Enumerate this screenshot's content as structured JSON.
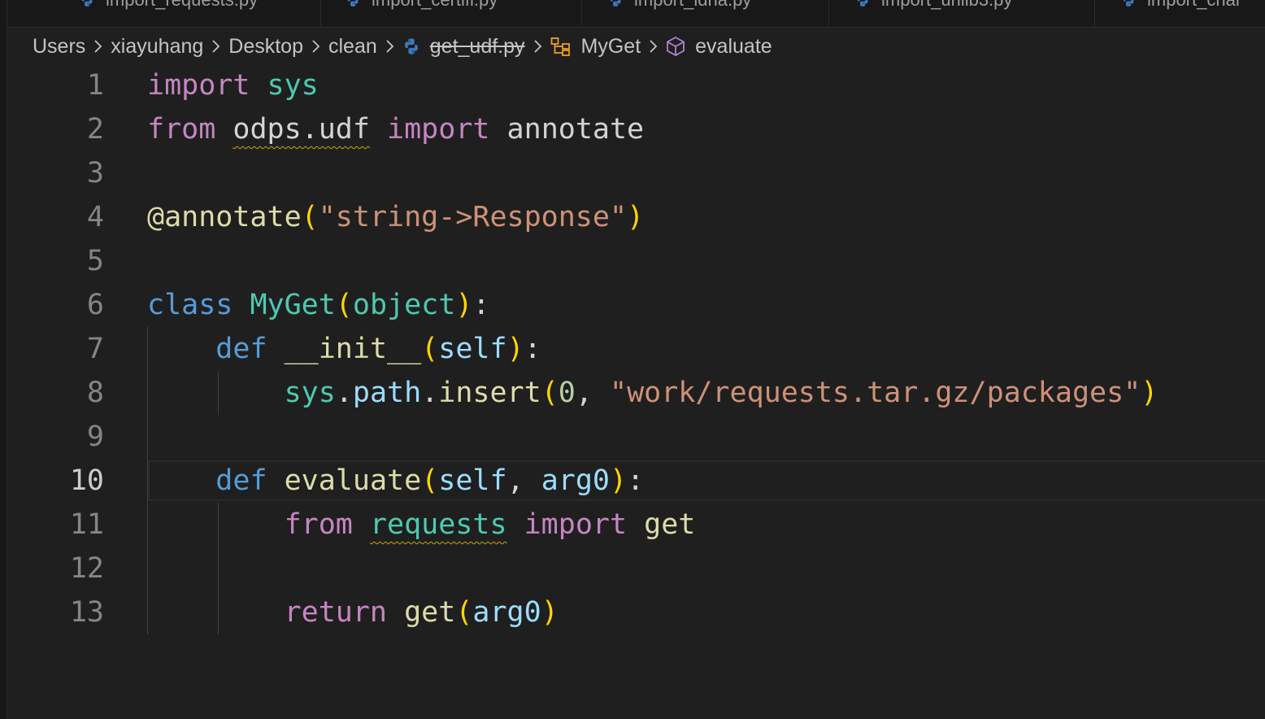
{
  "tabs": [
    {
      "label": "import_requests.py"
    },
    {
      "label": "import_certifi.py"
    },
    {
      "label": "import_idna.py"
    },
    {
      "label": "import_urllib3.py"
    },
    {
      "label": "import_char"
    }
  ],
  "breadcrumb": {
    "users": "Users",
    "user": "xiayuhang",
    "desktop": "Desktop",
    "folder": "clean",
    "file": "get_udf.py",
    "class": "MyGet",
    "method": "evaluate"
  },
  "editor": {
    "active_line": 10,
    "line_numbers": [
      "1",
      "2",
      "3",
      "4",
      "5",
      "6",
      "7",
      "8",
      "9",
      "10",
      "11",
      "12",
      "13"
    ],
    "code": {
      "l1": {
        "kw": "import",
        "mod": "sys"
      },
      "l2": {
        "kw1": "from",
        "mod": "odps.udf",
        "kw2": "import",
        "name": "annotate"
      },
      "l4": {
        "decorator": "@annotate",
        "open": "(",
        "str": "\"string->Response\"",
        "close": ")"
      },
      "l6": {
        "kw": "class",
        "name": "MyGet",
        "open": "(",
        "base": "object",
        "close": ")",
        "colon": ":"
      },
      "l7": {
        "kw": "def",
        "name": "__init__",
        "open": "(",
        "param": "self",
        "close": ")",
        "colon": ":"
      },
      "l8": {
        "obj": "sys",
        "dot1": ".",
        "attr": "path",
        "dot2": ".",
        "fn": "insert",
        "open": "(",
        "num": "0",
        "comma": ", ",
        "str": "\"work/requests.tar.gz/packages\"",
        "close": ")"
      },
      "l10": {
        "kw": "def",
        "name": "evaluate",
        "open": "(",
        "p1": "self",
        "comma": ", ",
        "p2": "arg0",
        "close": ")",
        "colon": ":"
      },
      "l11": {
        "kw1": "from",
        "mod": "requests",
        "kw2": "import",
        "name": "get"
      },
      "l13": {
        "kw": "return",
        "fn": "get",
        "open": "(",
        "arg": "arg0",
        "close": ")"
      }
    }
  },
  "colors": {
    "background": "#1f1f1f",
    "keyword_control": "#c586c0",
    "keyword_storage": "#569cd6",
    "type": "#4ec9b0",
    "function": "#dcdcaa",
    "string": "#ce9178",
    "variable": "#9cdcfe",
    "bracket": "#ffd700",
    "warning_squiggle": "#cca700"
  }
}
